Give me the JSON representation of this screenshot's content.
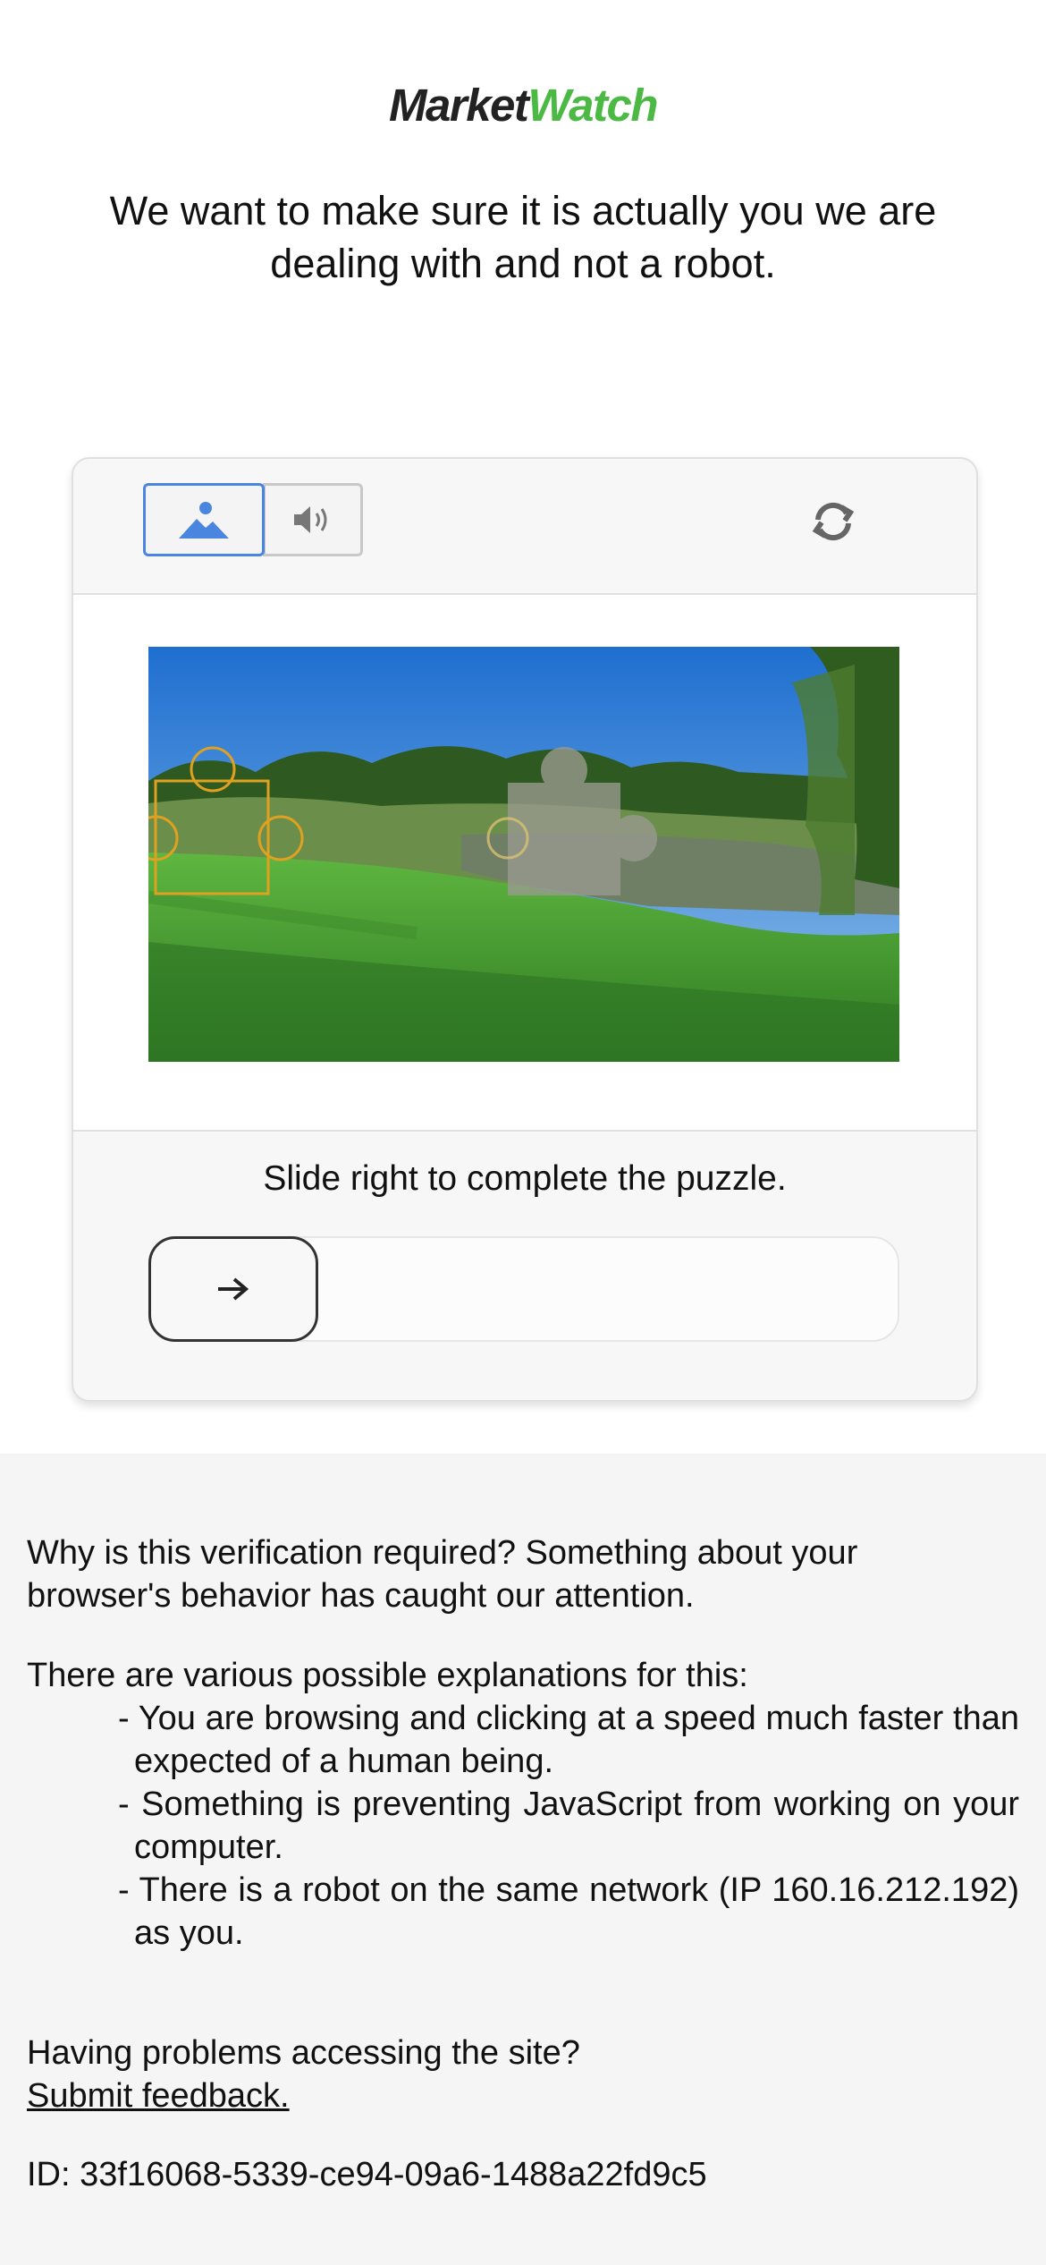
{
  "logo": {
    "part1": "Market",
    "part2": "Watch"
  },
  "headline": "We want to make sure it is actually you we are dealing with and not a robot.",
  "captcha": {
    "tabs": {
      "image_icon": "image-icon",
      "audio_icon": "speaker-icon"
    },
    "refresh_icon": "refresh-icon",
    "instruction": "Slide right to complete the puzzle.",
    "slider_icon": "arrow-right-icon"
  },
  "info": {
    "why_line1": "Why is this verification required? Something about your",
    "why_line2": "browser's behavior has caught our attention.",
    "various": "There are various possible explanations for this:",
    "reasons": [
      "- You are browsing and clicking at a speed much faster than expected of a human being.",
      "- Something is preventing JavaScript from working on your computer.",
      "- There is a robot on the same network (IP 160.16.212.192) as you."
    ],
    "problems": "Having problems accessing the site?",
    "feedback": "Submit feedback.",
    "id": "ID: 33f16068-5339-ce94-09a6-1488a22fd9c5"
  },
  "colors": {
    "accent": "#4a86e0",
    "brand_green": "#4cb944",
    "puzzle_outline": "#e0a020"
  }
}
